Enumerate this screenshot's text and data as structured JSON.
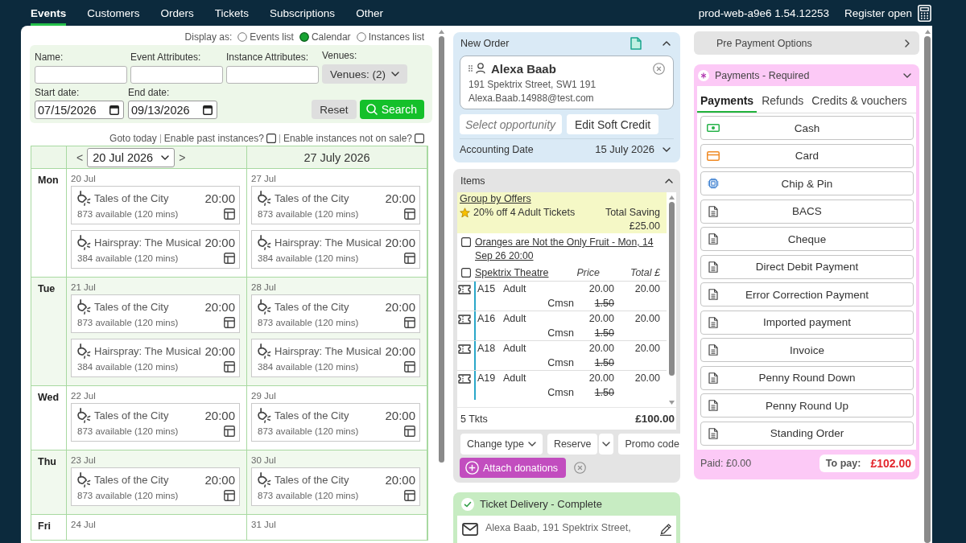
{
  "nav": {
    "tabs": [
      {
        "label": "Events",
        "selected": true
      },
      {
        "label": "Customers",
        "selected": false
      },
      {
        "label": "Orders",
        "selected": false
      },
      {
        "label": "Tickets",
        "selected": false
      },
      {
        "label": "Subscriptions",
        "selected": false
      },
      {
        "label": "Other",
        "selected": false
      }
    ],
    "server": "prod-web-a9e6 1.54.12253",
    "register": "Register open"
  },
  "events": {
    "display_as": {
      "label": "Display as:",
      "options": [
        {
          "label": "Events list",
          "selected": false
        },
        {
          "label": "Calendar",
          "selected": true
        },
        {
          "label": "Instances list",
          "selected": false
        }
      ]
    },
    "filters": {
      "text_fields": [
        {
          "label": "Name:"
        },
        {
          "label": "Event Attributes:"
        },
        {
          "label": "Instance Attributes:"
        }
      ],
      "venues": {
        "label": "Venues:",
        "value": "Venues: (2)"
      },
      "dates": [
        {
          "label": "Start date:",
          "value": "07/15/2026"
        },
        {
          "label": "End date:",
          "value": "09/13/2026"
        }
      ],
      "reset": "Reset",
      "search": "Search"
    },
    "toggles": {
      "goto_today": "Goto today",
      "checks": [
        {
          "label": "Enable past instances?",
          "checked": false
        },
        {
          "label": "Enable instances not on sale?",
          "checked": false
        }
      ]
    },
    "calendar": {
      "prev": "<",
      "week": "20 Jul 2026",
      "next": ">",
      "second_week": "27 July 2026",
      "rows": [
        {
          "day": "Mon",
          "cells": [
            {
              "date": "20 Jul",
              "events": [
                {
                  "title": "Tales of the City",
                  "time": "20:00",
                  "availability": "873 available (120 mins)"
                },
                {
                  "title": "Hairspray: The Musical",
                  "time": "20:00",
                  "availability": "384 available (120 mins)"
                }
              ]
            },
            {
              "date": "27 Jul",
              "events": [
                {
                  "title": "Tales of the City",
                  "time": "20:00",
                  "availability": "873 available (120 mins)"
                },
                {
                  "title": "Hairspray: The Musical",
                  "time": "20:00",
                  "availability": "384 available (120 mins)"
                }
              ]
            }
          ]
        },
        {
          "day": "Tue",
          "cells": [
            {
              "date": "21 Jul",
              "events": [
                {
                  "title": "Tales of the City",
                  "time": "20:00",
                  "availability": "873 available (120 mins)"
                },
                {
                  "title": "Hairspray: The Musical",
                  "time": "20:00",
                  "availability": "384 available (120 mins)"
                }
              ]
            },
            {
              "date": "28 Jul",
              "events": [
                {
                  "title": "Tales of the City",
                  "time": "20:00",
                  "availability": "873 available (120 mins)"
                },
                {
                  "title": "Hairspray: The Musical",
                  "time": "20:00",
                  "availability": "384 available (120 mins)"
                }
              ]
            }
          ]
        },
        {
          "day": "Wed",
          "cells": [
            {
              "date": "22 Jul",
              "events": [
                {
                  "title": "Tales of the City",
                  "time": "20:00",
                  "availability": "873 available (120 mins)"
                }
              ]
            },
            {
              "date": "29 Jul",
              "events": [
                {
                  "title": "Tales of the City",
                  "time": "20:00",
                  "availability": "873 available (120 mins)"
                }
              ]
            }
          ]
        },
        {
          "day": "Thu",
          "cells": [
            {
              "date": "23 Jul",
              "events": [
                {
                  "title": "Tales of the City",
                  "time": "20:00",
                  "availability": "873 available (120 mins)"
                }
              ]
            },
            {
              "date": "30 Jul",
              "events": [
                {
                  "title": "Tales of the City",
                  "time": "20:00",
                  "availability": "873 available (120 mins)"
                }
              ]
            }
          ]
        },
        {
          "day": "Fri",
          "cells": [
            {
              "date": "24 Jul"
            },
            {
              "date": "31 Jul"
            }
          ]
        }
      ]
    }
  },
  "order": {
    "title": "New Order",
    "customer": {
      "name": "Alexa Baab",
      "address": "191 Spektrix Street, SW1 191",
      "email": "Alexa.Baab.14988@test.com"
    },
    "opportunity": {
      "placeholder": "Select opportunity"
    },
    "soft_credit": "Edit Soft Credit",
    "accounting_date": {
      "label": "Accounting Date",
      "value": "15 July 2026"
    },
    "items": {
      "title": "Items",
      "offer": {
        "heading": "Group by Offers",
        "name": "20% off 4 Adult Tickets",
        "saving_label": "Total Saving",
        "saving": "£25.00"
      },
      "event": {
        "title": "Oranges are Not the Only Fruit - Mon, 14 Sep 26 20:00",
        "checked": false
      },
      "venue": {
        "name": "Spektrix Theatre",
        "checked": false
      },
      "columns": [
        "Price",
        "Total £"
      ],
      "tickets": [
        {
          "seat": "A15",
          "type": "Adult",
          "price": "20.00",
          "total": "20.00",
          "fee_label": "Cmsn",
          "fee": "1.50",
          "fee_waived": true
        },
        {
          "seat": "A16",
          "type": "Adult",
          "price": "20.00",
          "total": "20.00",
          "fee_label": "Cmsn",
          "fee": "1.50",
          "fee_waived": true
        },
        {
          "seat": "A18",
          "type": "Adult",
          "price": "20.00",
          "total": "20.00",
          "fee_label": "Cmsn",
          "fee": "1.50",
          "fee_waived": true
        },
        {
          "seat": "A19",
          "type": "Adult",
          "price": "20.00",
          "total": "20.00",
          "fee_label": "Cmsn",
          "fee": "1.50",
          "fee_waived": true
        }
      ],
      "count": "5 Tkts",
      "total": "£100.00",
      "buttons": [
        {
          "label": "Change type",
          "kind": "dropdown"
        },
        {
          "label": "Reserve",
          "kind": "split"
        },
        {
          "label": "Promo code",
          "kind": "plain"
        }
      ],
      "donation": "Attach donations"
    },
    "delivery": {
      "title": "Ticket Delivery - Complete",
      "complete": true,
      "address": "Alexa Baab, 191 Spektrix Street,"
    }
  },
  "pre_payment": {
    "title": "Pre Payment Options"
  },
  "payments": {
    "title": "Payments - Required",
    "required": true,
    "tabs": [
      {
        "label": "Payments",
        "selected": true
      },
      {
        "label": "Refunds",
        "selected": false
      },
      {
        "label": "Credits & vouchers",
        "selected": false
      }
    ],
    "methods": [
      {
        "label": "Cash",
        "kind": "cash"
      },
      {
        "label": "Card",
        "kind": "card"
      },
      {
        "label": "Chip & Pin",
        "kind": "chip"
      },
      {
        "label": "BACS",
        "kind": "document"
      },
      {
        "label": "Cheque",
        "kind": "document"
      },
      {
        "label": "Direct Debit Payment",
        "kind": "document"
      },
      {
        "label": "Error Correction Payment",
        "kind": "document"
      },
      {
        "label": "Imported payment",
        "kind": "document"
      },
      {
        "label": "Invoice",
        "kind": "document"
      },
      {
        "label": "Penny Round Down",
        "kind": "document"
      },
      {
        "label": "Penny Round Up",
        "kind": "document"
      },
      {
        "label": "Standing Order",
        "kind": "document"
      }
    ],
    "paid": "Paid: £0.00",
    "to_pay_label": "To pay:",
    "to_pay": "£102.00"
  }
}
